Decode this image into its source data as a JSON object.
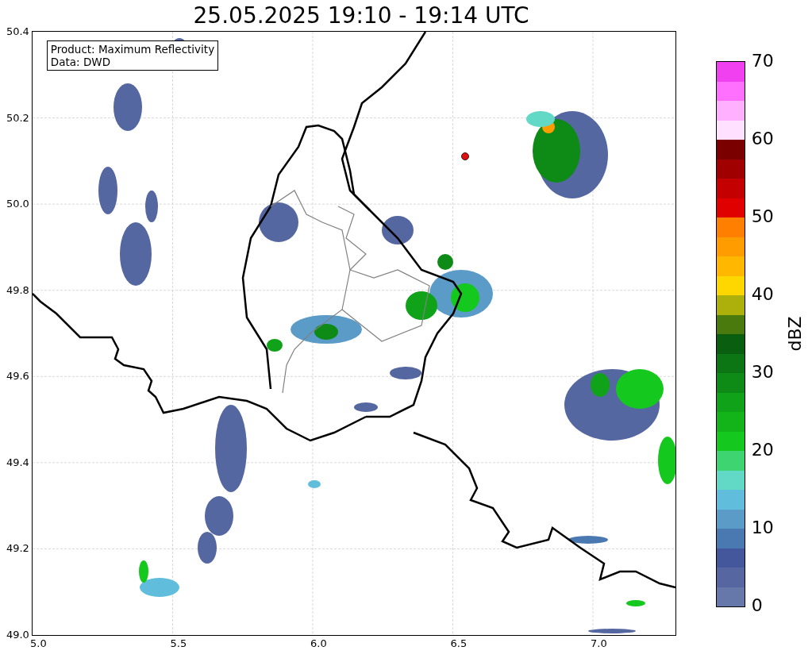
{
  "title": "25.05.2025 19:10 - 19:14 UTC",
  "info_box": "Product: Maximum Reflectivity\nData: DWD",
  "x_ticks": [
    "5.0",
    "5.5",
    "6.0",
    "6.5",
    "7.0"
  ],
  "y_ticks": [
    "50.4",
    "50.2",
    "50.0",
    "49.8",
    "49.6",
    "49.4",
    "49.2",
    "49.0"
  ],
  "colorbar": {
    "label": "dBZ",
    "ticks": [
      "70",
      "60",
      "50",
      "40",
      "30",
      "20",
      "10",
      "0"
    ],
    "segments": [
      {
        "color": "#f040f0"
      },
      {
        "color": "#ff70ff"
      },
      {
        "color": "#ffb0ff"
      },
      {
        "color": "#ffe0ff"
      },
      {
        "color": "#7a0000"
      },
      {
        "color": "#a00000"
      },
      {
        "color": "#c40000"
      },
      {
        "color": "#e00000"
      },
      {
        "color": "#ff7f00"
      },
      {
        "color": "#ff9c00"
      },
      {
        "color": "#ffb700"
      },
      {
        "color": "#ffd700"
      },
      {
        "color": "#adb00a"
      },
      {
        "color": "#4a7a0e"
      },
      {
        "color": "#0a5e10"
      },
      {
        "color": "#0c7614"
      },
      {
        "color": "#0e8a16"
      },
      {
        "color": "#10a218"
      },
      {
        "color": "#12b41a"
      },
      {
        "color": "#14c81e"
      },
      {
        "color": "#3ed471"
      },
      {
        "color": "#62d8c6"
      },
      {
        "color": "#60bedc"
      },
      {
        "color": "#5a9bc8"
      },
      {
        "color": "#4a78b0"
      },
      {
        "color": "#44579c"
      },
      {
        "color": "#5566a1"
      },
      {
        "color": "#6677a9"
      }
    ]
  }
}
